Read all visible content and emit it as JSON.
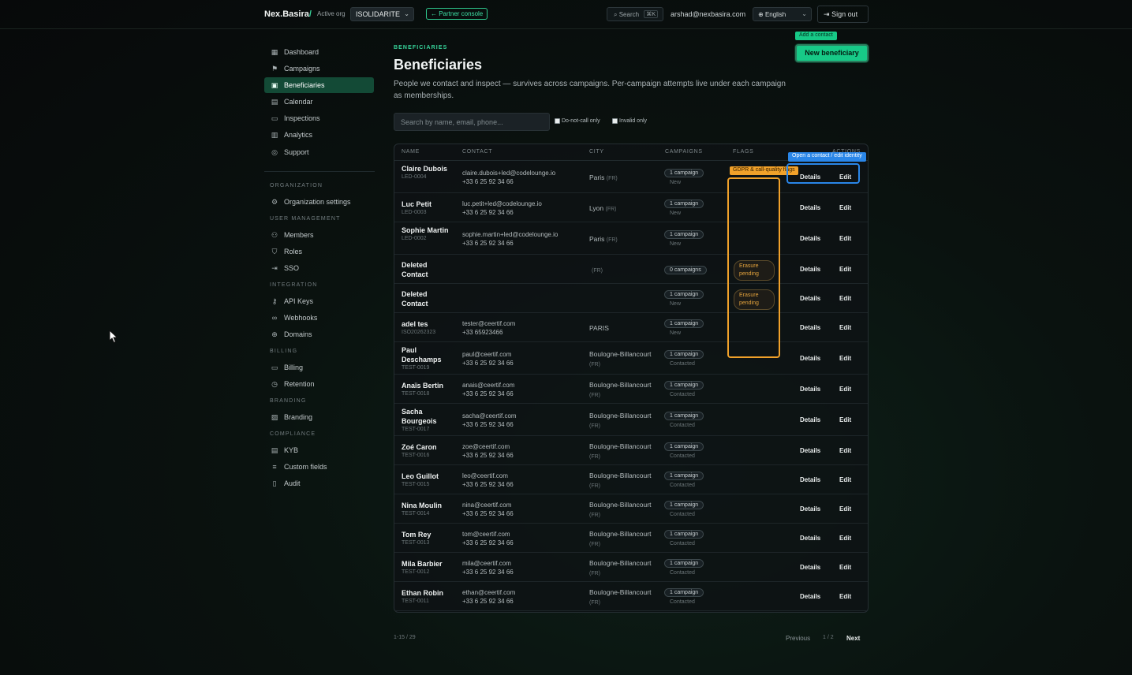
{
  "topbar": {
    "brand": "Nex.Basira",
    "brand_slash": "/",
    "active_org_label": "Active org",
    "active_org_value": "ISOLIDARITE",
    "partner_console": "← Partner console",
    "search_label": "Search",
    "search_shortcut": "⌘K",
    "user_email": "arshad@nexbasira.com",
    "language": "English",
    "sign_out": "Sign out"
  },
  "sidebar": {
    "main": [
      {
        "label": "Dashboard",
        "icon": "grid-icon"
      },
      {
        "label": "Campaigns",
        "icon": "flag-icon"
      },
      {
        "label": "Beneficiaries",
        "icon": "contact-card-icon",
        "active": true
      },
      {
        "label": "Calendar",
        "icon": "calendar-icon"
      },
      {
        "label": "Inspections",
        "icon": "video-icon"
      },
      {
        "label": "Analytics",
        "icon": "bar-chart-icon"
      },
      {
        "label": "Support",
        "icon": "lifebuoy-icon"
      }
    ],
    "sections": [
      {
        "title": "ORGANIZATION",
        "items": [
          {
            "label": "Organization settings",
            "icon": "gear-icon"
          }
        ]
      },
      {
        "title": "USER MANAGEMENT",
        "items": [
          {
            "label": "Members",
            "icon": "users-icon"
          },
          {
            "label": "Roles",
            "icon": "shield-icon"
          },
          {
            "label": "SSO",
            "icon": "login-icon"
          }
        ]
      },
      {
        "title": "INTEGRATION",
        "items": [
          {
            "label": "API Keys",
            "icon": "key-icon"
          },
          {
            "label": "Webhooks",
            "icon": "link-icon"
          },
          {
            "label": "Domains",
            "icon": "globe-icon"
          }
        ]
      },
      {
        "title": "BILLING",
        "items": [
          {
            "label": "Billing",
            "icon": "credit-card-icon"
          },
          {
            "label": "Retention",
            "icon": "clock-icon"
          }
        ]
      },
      {
        "title": "BRANDING",
        "items": [
          {
            "label": "Branding",
            "icon": "image-icon"
          }
        ]
      },
      {
        "title": "COMPLIANCE",
        "items": [
          {
            "label": "KYB",
            "icon": "document-check-icon"
          },
          {
            "label": "Custom fields",
            "icon": "list-icon"
          },
          {
            "label": "Audit",
            "icon": "file-icon"
          }
        ]
      }
    ]
  },
  "page": {
    "eyebrow": "BENEFICIARIES",
    "title": "Beneficiaries",
    "description": "People we contact and inspect — survives across campaigns. Per-campaign attempts live under each campaign as memberships.",
    "new_button": "New beneficiary",
    "tooltip_add": "Add a contact",
    "search_placeholder": "Search by name, email, phone...",
    "filter_dnc": "Do-not-call only",
    "filter_invalid": "Invalid only",
    "tooltip_gdpr": "GDPR & call-quality flags",
    "tooltip_open": "Open a contact / edit identity"
  },
  "table": {
    "columns": [
      "NAME",
      "CONTACT",
      "CITY",
      "CAMPAIGNS",
      "FLAGS",
      "ACTIONS"
    ],
    "details_label": "Details",
    "edit_label": "Edit",
    "rows": [
      {
        "name": "Claire Dubois",
        "id": "LED-0004",
        "email": "claire.dubois+led@codelounge.io",
        "phone": "+33 6 25 92 34 66",
        "city": "Paris",
        "country": "(FR)",
        "campaigns": "1 campaign",
        "status": "New",
        "flag": ""
      },
      {
        "name": "Luc Petit",
        "id": "LED-0003",
        "email": "luc.petit+led@codelounge.io",
        "phone": "+33 6 25 92 34 66",
        "city": "Lyon",
        "country": "(FR)",
        "campaigns": "1 campaign",
        "status": "New",
        "flag": ""
      },
      {
        "name": "Sophie Martin",
        "id": "LED-0002",
        "email": "sophie.martin+led@codelounge.io",
        "phone": "+33 6 25 92 34 66",
        "city": "Paris",
        "country": "(FR)",
        "campaigns": "1 campaign",
        "status": "New",
        "flag": ""
      },
      {
        "name": "Deleted Contact",
        "id": "",
        "email": "",
        "phone": "",
        "city": "",
        "country": "(FR)",
        "campaigns": "0 campaigns",
        "status": "",
        "flag": "Erasure pending"
      },
      {
        "name": "Deleted Contact",
        "id": "",
        "email": "",
        "phone": "",
        "city": "",
        "country": "",
        "campaigns": "1 campaign",
        "status": "New",
        "flag": "Erasure pending"
      },
      {
        "name": "adel tes",
        "id": "ISO20262323",
        "email": "tester@ceertif.com",
        "phone": "+33 65923466",
        "city": "PARIS",
        "country": "",
        "campaigns": "1 campaign",
        "status": "New",
        "flag": ""
      },
      {
        "name": "Paul Deschamps",
        "id": "TEST-0019",
        "email": "paul@ceertif.com",
        "phone": "+33 6 25 92 34 66",
        "city": "Boulogne-Billancourt",
        "country": "(FR)",
        "campaigns": "1 campaign",
        "status": "Contacted",
        "flag": ""
      },
      {
        "name": "Anaïs Bertin",
        "id": "TEST-0018",
        "email": "anais@ceertif.com",
        "phone": "+33 6 25 92 34 66",
        "city": "Boulogne-Billancourt",
        "country": "(FR)",
        "campaigns": "1 campaign",
        "status": "Contacted",
        "flag": ""
      },
      {
        "name": "Sacha Bourgeois",
        "id": "TEST-0017",
        "email": "sacha@ceertif.com",
        "phone": "+33 6 25 92 34 66",
        "city": "Boulogne-Billancourt",
        "country": "(FR)",
        "campaigns": "1 campaign",
        "status": "Contacted",
        "flag": ""
      },
      {
        "name": "Zoé Caron",
        "id": "TEST-0016",
        "email": "zoe@ceertif.com",
        "phone": "+33 6 25 92 34 66",
        "city": "Boulogne-Billancourt",
        "country": "(FR)",
        "campaigns": "1 campaign",
        "status": "Contacted",
        "flag": ""
      },
      {
        "name": "Leo Guillot",
        "id": "TEST-0015",
        "email": "leo@ceertif.com",
        "phone": "+33 6 25 92 34 66",
        "city": "Boulogne-Billancourt",
        "country": "(FR)",
        "campaigns": "1 campaign",
        "status": "Contacted",
        "flag": ""
      },
      {
        "name": "Nina Moulin",
        "id": "TEST-0014",
        "email": "nina@ceertif.com",
        "phone": "+33 6 25 92 34 66",
        "city": "Boulogne-Billancourt",
        "country": "(FR)",
        "campaigns": "1 campaign",
        "status": "Contacted",
        "flag": ""
      },
      {
        "name": "Tom Rey",
        "id": "TEST-0013",
        "email": "tom@ceertif.com",
        "phone": "+33 6 25 92 34 66",
        "city": "Boulogne-Billancourt",
        "country": "(FR)",
        "campaigns": "1 campaign",
        "status": "Contacted",
        "flag": ""
      },
      {
        "name": "Mila Barbier",
        "id": "TEST-0012",
        "email": "mila@ceertif.com",
        "phone": "+33 6 25 92 34 66",
        "city": "Boulogne-Billancourt",
        "country": "(FR)",
        "campaigns": "1 campaign",
        "status": "Contacted",
        "flag": ""
      },
      {
        "name": "Ethan Robin",
        "id": "TEST-0011",
        "email": "ethan@ceertif.com",
        "phone": "+33 6 25 92 34 66",
        "city": "Boulogne-Billancourt",
        "country": "(FR)",
        "campaigns": "1 campaign",
        "status": "Contacted",
        "flag": ""
      }
    ]
  },
  "pagination": {
    "range": "1-15 / 29",
    "previous": "Previous",
    "page": "1 / 2",
    "next": "Next"
  },
  "colors": {
    "accent": "#17c987",
    "flag_highlight": "#f0a12a",
    "info_highlight": "#2a86e8"
  }
}
